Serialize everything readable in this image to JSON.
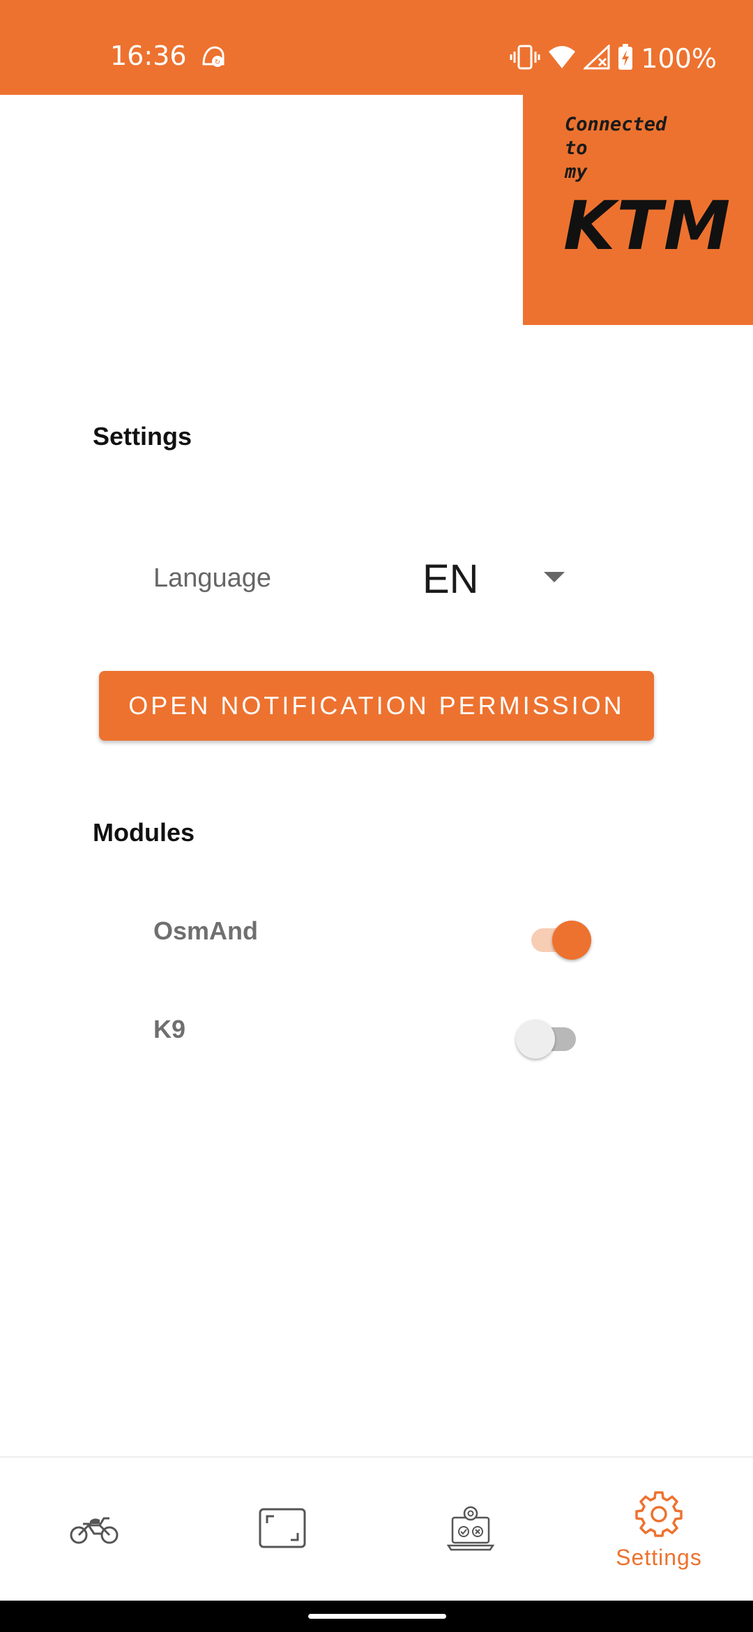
{
  "status_bar": {
    "time": "16:36",
    "battery": "100%",
    "icons": [
      "app-notification-icon",
      "vibrate-icon",
      "wifi-icon",
      "signal-icon",
      "battery-charging-icon"
    ]
  },
  "logo": {
    "line1": "Connected",
    "line2": "to",
    "line3": "my",
    "brand": "KTM"
  },
  "settings": {
    "title": "Settings",
    "language_label": "Language",
    "language_value": "EN",
    "notification_button": "OPEN NOTIFICATION PERMISSION"
  },
  "modules": {
    "title": "Modules",
    "items": [
      {
        "label": "OsmAnd",
        "enabled": true
      },
      {
        "label": "K9",
        "enabled": false
      }
    ]
  },
  "bottom_nav": {
    "items": [
      {
        "icon": "motorcycle-icon",
        "label": ""
      },
      {
        "icon": "screen-frame-icon",
        "label": ""
      },
      {
        "icon": "laptop-settings-icon",
        "label": ""
      },
      {
        "icon": "gear-icon",
        "label": "Settings",
        "active": true
      }
    ]
  },
  "colors": {
    "accent": "#ED722F",
    "text_dark": "#111111",
    "text_muted": "#666666",
    "nav_icon": "#555555"
  }
}
